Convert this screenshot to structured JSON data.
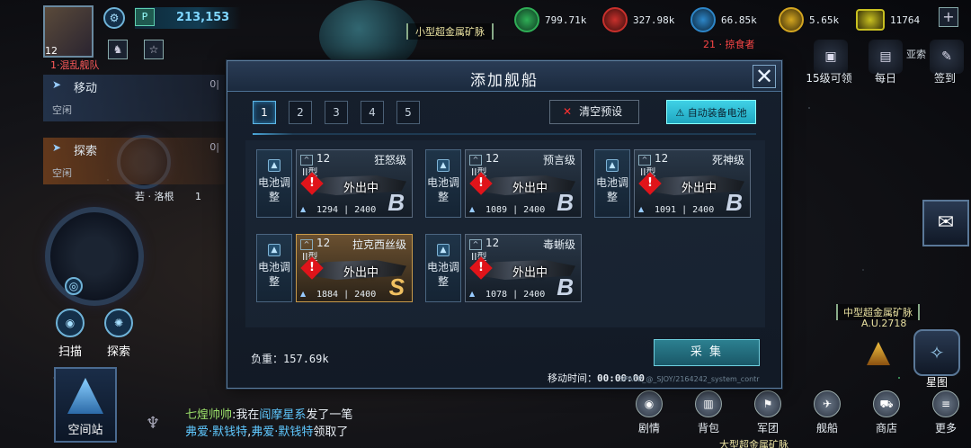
{
  "player": {
    "level": "12",
    "power": "213,153",
    "power_tag": "P",
    "fleet_name": "混乱舰队",
    "fleet_prefix": "1·"
  },
  "resources": [
    {
      "name": "green-resource",
      "value": "799.71k",
      "color": "#2fae56"
    },
    {
      "name": "red-resource",
      "value": "327.98k",
      "color": "#c8302c"
    },
    {
      "name": "blue-resource",
      "value": "66.85k",
      "color": "#2d86c8"
    },
    {
      "name": "gold-resource",
      "value": "5.65k",
      "color": "#d4a620"
    },
    {
      "name": "chain-resource",
      "value": "11764",
      "color": "#c8c020"
    }
  ],
  "map_labels": {
    "small_mine": "小型超金属矿脉",
    "enemy": "21 · 掠食者",
    "medium_mine": "中型超金属矿脉",
    "medium_mine_sub": "A.U.2718",
    "large_mine": "大型超金属矿脉",
    "station_owner": "若 · 洛根",
    "station_owner_num": "1"
  },
  "top_right": {
    "level_reward": "15级可领",
    "daily": "每日",
    "signin": "签到",
    "partial_label": "亚索"
  },
  "side_panels": [
    {
      "title": "移动",
      "status": "空闲",
      "count": "0|"
    },
    {
      "title": "探索",
      "status": "空闲",
      "count": "0|"
    }
  ],
  "left_buttons": {
    "scan": "扫描",
    "explore": "探索",
    "station": "空间站"
  },
  "bottom_nav": [
    "剧情",
    "背包",
    "军团",
    "舰船",
    "商店",
    "更多"
  ],
  "star_map": "星图",
  "chat": {
    "line1_name": "七煌帅帅",
    "line1_text_a": ":我在",
    "line1_hl": "阎摩星系",
    "line1_text_b": "发了一笔",
    "line2_a": "弗爱·默钱特",
    "line2_sep": ",",
    "line2_b": "弗爱·默钱特",
    "line2_text": "领取了"
  },
  "modal": {
    "title": "添加舰船",
    "close": "✕",
    "tabs": [
      "1",
      "2",
      "3",
      "4",
      "5"
    ],
    "active_tab": 0,
    "clear_preset": "清空预设",
    "auto_battery": "自动装备电池",
    "battery_label": "电池调整",
    "ships": [
      {
        "level": "12",
        "class": "狂怒级",
        "type": "II型",
        "status": "外出中",
        "durability": "1294 | 2400",
        "rank": "B",
        "gold": false
      },
      {
        "level": "12",
        "class": "预言级",
        "type": "II型",
        "status": "外出中",
        "durability": "1089 | 2400",
        "rank": "B",
        "gold": false
      },
      {
        "level": "12",
        "class": "死神级",
        "type": "II型",
        "status": "外出中",
        "durability": "1091 | 2400",
        "rank": "B",
        "gold": false
      },
      {
        "level": "12",
        "class": "拉克西丝级",
        "type": "II型",
        "status": "外出中",
        "durability": "1884 | 2400",
        "rank": "S",
        "gold": true
      },
      {
        "level": "12",
        "class": "毒蜥级",
        "type": "II型",
        "status": "外出中",
        "durability": "1078 | 2400",
        "rank": "B",
        "gold": false
      }
    ],
    "load_label": "负重：",
    "load_value": "157.69k",
    "collect": "采 集",
    "move_time_label": "移动时间：",
    "move_time_value": "00:00:00",
    "path_note": "SPACE_@_SJOY/2164242_system_contr"
  }
}
